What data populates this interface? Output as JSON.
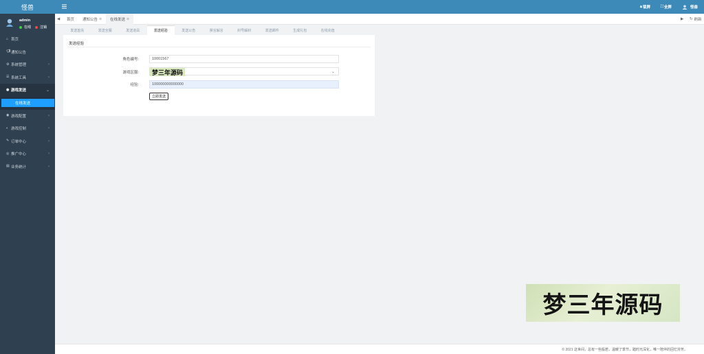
{
  "brand": {
    "title": "怪兽"
  },
  "user": {
    "name": "admin",
    "status_online": "在线",
    "status_logout": "注销"
  },
  "sidebar": {
    "items": [
      {
        "label": "首页",
        "icon": "home-icon",
        "has_arrow": false
      },
      {
        "label": "通知公告",
        "icon": "megaphone-icon",
        "has_arrow": false
      },
      {
        "label": "系统管理",
        "icon": "gear-icon",
        "has_arrow": true
      },
      {
        "label": "系统工具",
        "icon": "list-icon",
        "has_arrow": true
      },
      {
        "label": "游戏发送",
        "icon": "gamepad-icon",
        "has_arrow": true,
        "open": true
      },
      {
        "label": "游戏配置",
        "icon": "gamepad-icon",
        "has_arrow": true
      },
      {
        "label": "游戏控制",
        "icon": "control-icon",
        "has_arrow": true
      },
      {
        "label": "订单中心",
        "icon": "pencil-icon",
        "has_arrow": true
      },
      {
        "label": "推广中心",
        "icon": "eye-icon",
        "has_arrow": true
      },
      {
        "label": "业务统计",
        "icon": "chart-icon",
        "has_arrow": true
      }
    ],
    "active_sub": "在线发送"
  },
  "topbar": {
    "lock_label": "锁屏",
    "fullscreen_label": "全屏",
    "user_label": "怪兽"
  },
  "tabs": [
    {
      "label": "首页",
      "closable": false
    },
    {
      "label": "通知公告",
      "closable": true
    },
    {
      "label": "在线发送",
      "closable": true,
      "active": true
    }
  ],
  "refresh_label": "刷新",
  "subtabs": [
    "发送首充",
    "发送全服",
    "发送道具",
    "发送经验",
    "发送公告",
    "禁言解言",
    "封号解封",
    "发送邮件",
    "生成礼包",
    "在线充值"
  ],
  "active_subtab": "发送经验",
  "panel": {
    "title": "发送经验",
    "role_label": "角色编号:",
    "role_value": "10001567",
    "zone_label": "游戏区服:",
    "zone_watermark": "梦三年源码",
    "exp_label": "经验:",
    "exp_value": "100000000000000",
    "submit_label": "立即发送"
  },
  "watermark": "梦三年源码",
  "footer": "© 2021 这世间，总有一些般若，温暖了季节，踏时光深化，唯一陪伴的回忆芬芳。",
  "colors": {
    "topbar": "#3d8ab8",
    "sidebar": "#2f4050",
    "active_sub": "#1e9fff"
  }
}
